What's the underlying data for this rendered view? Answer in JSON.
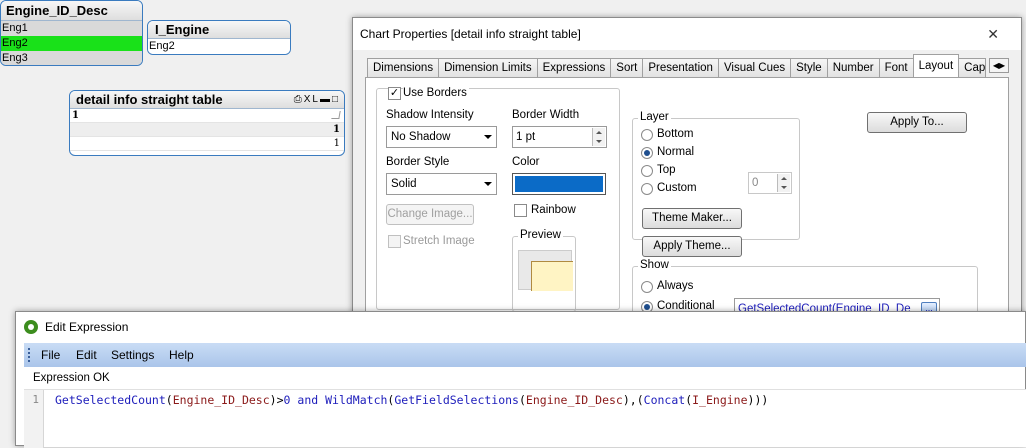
{
  "listbox_engine_id_desc": {
    "title": "Engine_ID_Desc",
    "items": [
      "Eng1",
      "Eng2",
      "Eng3"
    ],
    "selected": "Eng2"
  },
  "listbox_i_engine": {
    "title": "I_Engine",
    "items": [
      "Eng2"
    ]
  },
  "straight_table": {
    "title": "detail info straight table",
    "caption_icons": "XL",
    "header_value": "1",
    "total_value": "1",
    "row_value": "1"
  },
  "chart_properties": {
    "title": "Chart Properties [detail info straight table]",
    "close": "✕",
    "tabs": [
      "Dimensions",
      "Dimension Limits",
      "Expressions",
      "Sort",
      "Presentation",
      "Visual Cues",
      "Style",
      "Number",
      "Font",
      "Layout",
      "Cap"
    ],
    "active_tab": "Layout",
    "use_borders_label": "Use Borders",
    "use_borders_checked": true,
    "shadow_intensity_label": "Shadow Intensity",
    "shadow_intensity_value": "No Shadow",
    "border_width_label": "Border Width",
    "border_width_value": "1 pt",
    "border_style_label": "Border Style",
    "border_style_value": "Solid",
    "color_label": "Color",
    "color_value": "#0b6bc7",
    "change_image_label": "Change Image...",
    "rainbow_label": "Rainbow",
    "stretch_image_label": "Stretch Image",
    "preview_label": "Preview",
    "layer_label": "Layer",
    "layer_options": [
      "Bottom",
      "Normal",
      "Top",
      "Custom"
    ],
    "layer_selected": "Normal",
    "custom_value": "0",
    "apply_to_label": "Apply To...",
    "theme_maker_label": "Theme Maker...",
    "apply_theme_label": "Apply Theme...",
    "show_label": "Show",
    "show_always_label": "Always",
    "show_conditional_label": "Conditional",
    "show_selected": "Conditional",
    "condition_value": "GetSelectedCount(Engine_ID_De",
    "condition_button": "..."
  },
  "edit_expression": {
    "title": "Edit Expression",
    "menu": [
      "File",
      "Edit",
      "Settings",
      "Help"
    ],
    "status": "Expression OK",
    "line_number": "1",
    "code_tokens": [
      {
        "t": "GetSelectedCount",
        "c": "fn"
      },
      {
        "t": "(",
        "c": "op"
      },
      {
        "t": "Engine_ID_Desc",
        "c": "fld"
      },
      {
        "t": ")>",
        "c": "op"
      },
      {
        "t": "0",
        "c": "num"
      },
      {
        "t": " ",
        "c": "op"
      },
      {
        "t": "and",
        "c": "kw"
      },
      {
        "t": " ",
        "c": "op"
      },
      {
        "t": "WildMatch",
        "c": "fn"
      },
      {
        "t": "(",
        "c": "op"
      },
      {
        "t": "GetFieldSelections",
        "c": "fn"
      },
      {
        "t": "(",
        "c": "op"
      },
      {
        "t": "Engine_ID_Desc",
        "c": "fld"
      },
      {
        "t": "),(",
        "c": "op"
      },
      {
        "t": "Concat",
        "c": "fn"
      },
      {
        "t": "(",
        "c": "op"
      },
      {
        "t": "I_Engine",
        "c": "fld"
      },
      {
        "t": ")))",
        "c": "op"
      }
    ]
  }
}
